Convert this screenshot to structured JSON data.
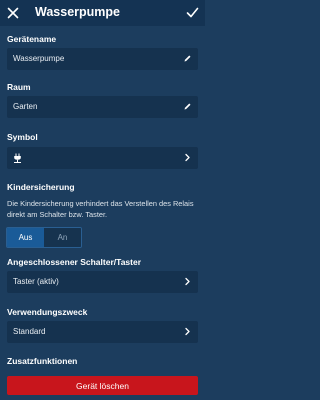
{
  "header": {
    "title": "Wasserpumpe"
  },
  "device_name": {
    "label": "Gerätename",
    "value": "Wasserpumpe"
  },
  "room": {
    "label": "Raum",
    "value": "Garten"
  },
  "symbol": {
    "label": "Symbol"
  },
  "child_lock": {
    "label": "Kindersicherung",
    "description": "Die Kindersicherung verhindert das Verstellen des Relais direkt am Schalter bzw. Taster.",
    "options": [
      "Aus",
      "An"
    ],
    "selected": "Aus"
  },
  "switch": {
    "label": "Angeschlossener Schalter/Taster",
    "value": "Taster (aktiv)"
  },
  "usage": {
    "label": "Verwendungszweck",
    "value": "Standard"
  },
  "extras": {
    "label": "Zusatzfunktionen"
  },
  "delete_button": {
    "label": "Gerät löschen"
  },
  "colors": {
    "background": "#1c3d5e",
    "field": "#15324f",
    "accent": "#1a5b98",
    "danger": "#c8151c"
  },
  "icons": {
    "back": "close-icon",
    "confirm": "check-icon",
    "edit": "pencil-icon",
    "nav": "chevron-right-icon",
    "symbol": "plug-icon"
  }
}
